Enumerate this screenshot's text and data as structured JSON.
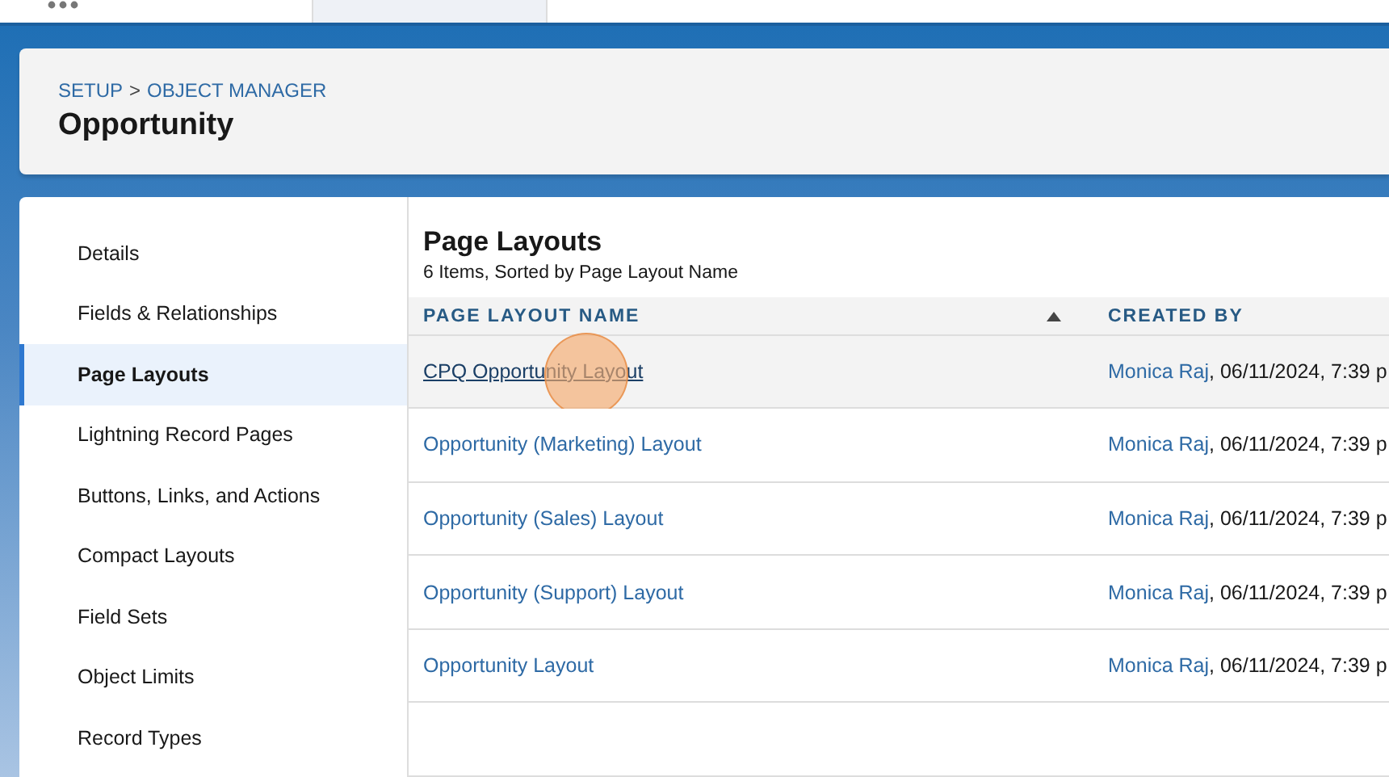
{
  "top_tabs": [
    {
      "selected": false
    },
    {
      "selected": true
    }
  ],
  "header": {
    "breadcrumb": [
      {
        "label": "SETUP"
      },
      {
        "label": "OBJECT MANAGER"
      }
    ],
    "separator": ">",
    "title": "Opportunity"
  },
  "sidebar": {
    "items": [
      {
        "label": "Details",
        "selected": false
      },
      {
        "label": "Fields & Relationships",
        "selected": false
      },
      {
        "label": "Page Layouts",
        "selected": true
      },
      {
        "label": "Lightning Record Pages",
        "selected": false
      },
      {
        "label": "Buttons, Links, and Actions",
        "selected": false
      },
      {
        "label": "Compact Layouts",
        "selected": false
      },
      {
        "label": "Field Sets",
        "selected": false
      },
      {
        "label": "Object Limits",
        "selected": false
      },
      {
        "label": "Record Types",
        "selected": false
      }
    ]
  },
  "list": {
    "title": "Page Layouts",
    "subtitle": "6 Items, Sorted by Page Layout Name",
    "columns": [
      {
        "label": "PAGE LAYOUT NAME",
        "sorted": true
      },
      {
        "label": "CREATED BY",
        "sorted": false
      }
    ],
    "rows": [
      {
        "name": "CPQ Opportunity Layout",
        "user": "Monica Raj",
        "date": ", 06/11/2024, 7:39 p",
        "selected": true,
        "clicked": true
      },
      {
        "name": "Opportunity (Marketing) Layout",
        "user": "Monica Raj",
        "date": ", 06/11/2024, 7:39 p",
        "selected": false,
        "clicked": false
      },
      {
        "name": "Opportunity (Sales) Layout",
        "user": "Monica Raj",
        "date": ", 06/11/2024, 7:39 p",
        "selected": false,
        "clicked": false
      },
      {
        "name": "Opportunity (Support) Layout",
        "user": "Monica Raj",
        "date": ", 06/11/2024, 7:39 p",
        "selected": false,
        "clicked": false
      },
      {
        "name": "Opportunity Layout",
        "user": "Monica Raj",
        "date": ", 06/11/2024, 7:39 p",
        "selected": false,
        "clicked": false
      },
      {
        "selected": false,
        "clicked": false
      }
    ]
  }
}
